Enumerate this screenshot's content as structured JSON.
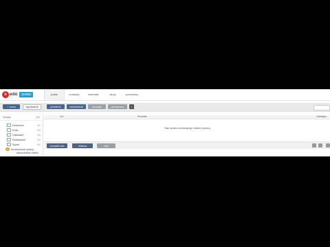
{
  "logo": {
    "mark": "e",
    "text": "wiki",
    "badge": "postar"
  },
  "nav": [
    "pošta",
    "kontakty",
    "kalendář",
    "úkoly",
    "poznámky"
  ],
  "toolbar": {
    "new_label": "+ nová",
    "empty_folder_label": "vyprázdnit",
    "read_label": "přečtené",
    "unread_label": "nepřečtené",
    "delete_label": "smazat",
    "move_label": "přesunout",
    "plus_label": "+"
  },
  "sidebar": {
    "header": "Složky",
    "header_count": "1/1",
    "folders": [
      {
        "label": "Doručená",
        "count": "0/1"
      },
      {
        "label": "Koše",
        "count": "0/0"
      },
      {
        "label": "Odeslané",
        "count": "0/0"
      },
      {
        "label": "Rozepsané",
        "count": "0/0"
      },
      {
        "label": "Spam",
        "count": "0/0"
      },
      {
        "label": "Archivované zprávy",
        "count": ""
      },
      {
        "label": "automatické třídění",
        "count": ""
      }
    ]
  },
  "table": {
    "col_from": "Od",
    "col_subject": "Předmět",
    "col_date": "Odesláno",
    "empty_text": "Tato složka neobsahuje žádné zprávy."
  },
  "footer": {
    "select_label": "Označit vše",
    "threads_label": "Vlákna",
    "info_label": "Info"
  }
}
